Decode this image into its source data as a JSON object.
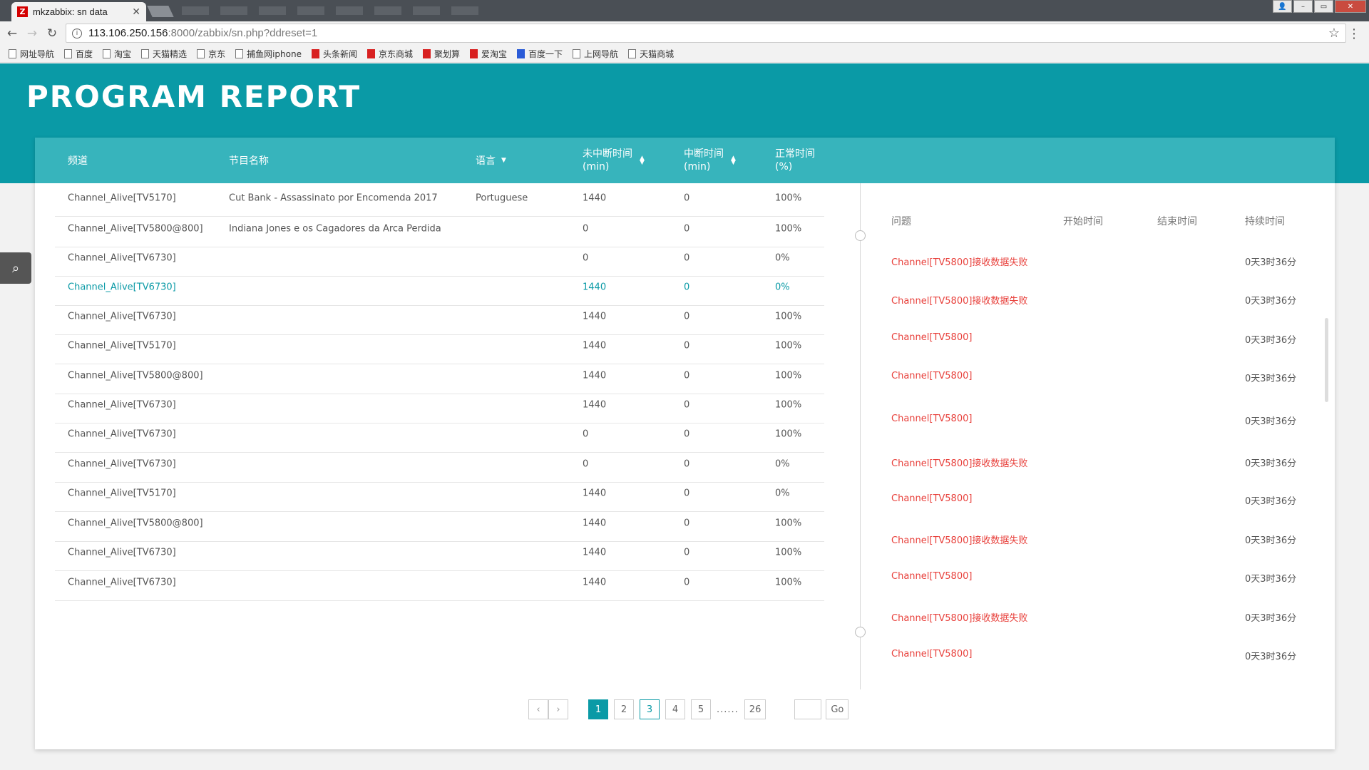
{
  "browser": {
    "tab_title": "mkzabbix: sn data",
    "tab_favicon": "Z",
    "url_host": "113.106.250.156",
    "url_path": ":8000/zabbix/sn.php?ddreset=1",
    "bookmarks": [
      "网址导航",
      "百度",
      "淘宝",
      "天猫精选",
      "京东",
      "捕鱼网iphone",
      "头条新闻",
      "京东商城",
      "聚划算",
      "爱淘宝",
      "百度一下",
      "上网导航",
      "天猫商城"
    ]
  },
  "page": {
    "title": "PROGRAM REPORT",
    "accent": "#0a9aa6",
    "header_bg": "#37b4bc",
    "alert_color": "#e8413c"
  },
  "table": {
    "columns": {
      "channel": "频道",
      "program": "节目名称",
      "language": "语言",
      "uninterrupted": "未中断时间",
      "uninterrupted_unit": "(min)",
      "interrupted": "中断时间",
      "interrupted_unit": "(min)",
      "normal": "正常时间",
      "normal_unit": "(%)"
    },
    "rows": [
      {
        "channel": "Channel_Alive[TV5170]",
        "program": "Cut Bank - Assassinato por  Encomenda 2017",
        "language": "Portuguese",
        "uninterrupted": "1440",
        "interrupted": "0",
        "normal": "100%"
      },
      {
        "channel": "Channel_Alive[TV5800@800]",
        "program": "Indiana Jones e os Cagadores da Arca Perdida",
        "language": "",
        "uninterrupted": "0",
        "interrupted": "0",
        "normal": "100%"
      },
      {
        "channel": "Channel_Alive[TV6730]",
        "program": "",
        "language": "",
        "uninterrupted": "0",
        "interrupted": "0",
        "normal": "0%"
      },
      {
        "channel": "Channel_Alive[TV6730]",
        "program": "",
        "language": "",
        "uninterrupted": "1440",
        "interrupted": "0",
        "normal": "0%"
      },
      {
        "channel": "Channel_Alive[TV6730]",
        "program": "",
        "language": "",
        "uninterrupted": "1440",
        "interrupted": "0",
        "normal": "100%"
      },
      {
        "channel": "Channel_Alive[TV5170]",
        "program": "",
        "language": "",
        "uninterrupted": "1440",
        "interrupted": "0",
        "normal": "100%"
      },
      {
        "channel": "Channel_Alive[TV5800@800]",
        "program": "",
        "language": "",
        "uninterrupted": "1440",
        "interrupted": "0",
        "normal": "100%"
      },
      {
        "channel": "Channel_Alive[TV6730]",
        "program": "",
        "language": "",
        "uninterrupted": "1440",
        "interrupted": "0",
        "normal": "100%"
      },
      {
        "channel": "Channel_Alive[TV6730]",
        "program": "",
        "language": "",
        "uninterrupted": "0",
        "interrupted": "0",
        "normal": "100%"
      },
      {
        "channel": "Channel_Alive[TV6730]",
        "program": "",
        "language": "",
        "uninterrupted": "0",
        "interrupted": "0",
        "normal": "0%"
      },
      {
        "channel": "Channel_Alive[TV5170]",
        "program": "",
        "language": "",
        "uninterrupted": "1440",
        "interrupted": "0",
        "normal": "0%"
      },
      {
        "channel": "Channel_Alive[TV5800@800]",
        "program": "",
        "language": "",
        "uninterrupted": "1440",
        "interrupted": "0",
        "normal": "100%"
      },
      {
        "channel": "Channel_Alive[TV6730]",
        "program": "",
        "language": "",
        "uninterrupted": "1440",
        "interrupted": "0",
        "normal": "100%"
      },
      {
        "channel": "Channel_Alive[TV6730]",
        "program": "",
        "language": "",
        "uninterrupted": "1440",
        "interrupted": "0",
        "normal": "100%"
      }
    ],
    "active_row": 3
  },
  "issues": {
    "columns": {
      "problem": "问题",
      "start": "开始时间",
      "end": "结束时间",
      "duration": "持续时间"
    },
    "rows": [
      {
        "name": "Channel[TV5800]接收数据失败",
        "duration": "0天3时36分"
      },
      {
        "name": "Channel[TV5800]接收数据失败",
        "duration": "0天3时36分"
      },
      {
        "name": "Channel[TV5800]",
        "duration": "0天3时36分"
      },
      {
        "name": "Channel[TV5800]",
        "duration": "0天3时36分"
      },
      {
        "name": "Channel[TV5800]",
        "duration": "0天3时36分"
      },
      {
        "name": "Channel[TV5800]接收数据失败",
        "duration": "0天3时36分"
      },
      {
        "name": "Channel[TV5800]",
        "duration": "0天3时36分"
      },
      {
        "name": "Channel[TV5800]接收数据失败",
        "duration": "0天3时36分"
      },
      {
        "name": "Channel[TV5800]",
        "duration": "0天3时36分"
      },
      {
        "name": "Channel[TV5800]接收数据失败",
        "duration": "0天3时36分"
      },
      {
        "name": "Channel[TV5800]",
        "duration": "0天3时36分"
      }
    ]
  },
  "pagination": {
    "pages": [
      "1",
      "2",
      "3",
      "4",
      "5"
    ],
    "current": "1",
    "ellipsis": "......",
    "last": "26",
    "go_label": "Go"
  }
}
